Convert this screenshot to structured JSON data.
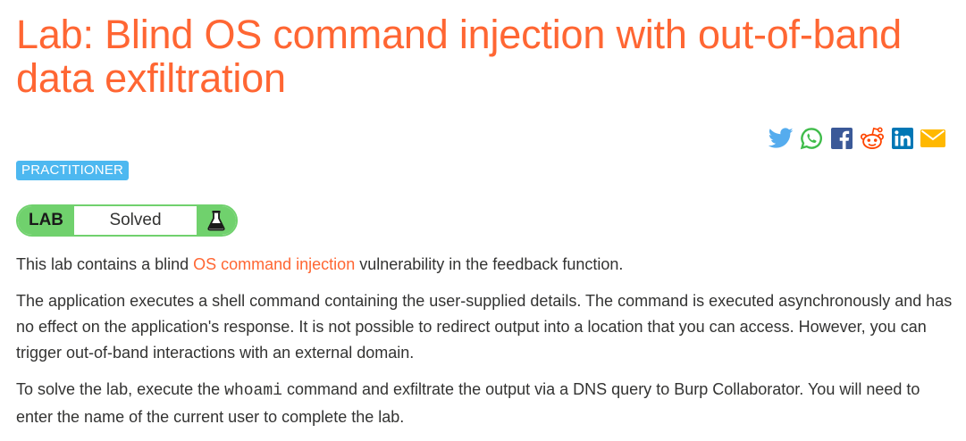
{
  "title": "Lab: Blind OS command injection with out-of-band data exfiltration",
  "share": {
    "icons": [
      "twitter-icon",
      "whatsapp-icon",
      "facebook-icon",
      "reddit-icon",
      "linkedin-icon",
      "email-icon"
    ],
    "colors": {
      "twitter": "#55acee",
      "whatsapp": "#3fbc4a",
      "facebook": "#3b5998",
      "reddit": "#ff4500",
      "linkedin": "#0077b5",
      "email": "#ffb800"
    }
  },
  "level_badge": "PRACTITIONER",
  "status": {
    "tag": "LAB",
    "text": "Solved"
  },
  "description": {
    "p1_before": "This lab contains a blind ",
    "p1_link": "OS command injection",
    "p1_after": " vulnerability in the feedback function.",
    "p2": "The application executes a shell command containing the user-supplied details. The command is executed asynchronously and has no effect on the application's response. It is not possible to redirect output into a location that you can access. However, you can trigger out-of-band interactions with an external domain.",
    "p3_before": "To solve the lab, execute the ",
    "p3_code": "whoami",
    "p3_after": " command and exfiltrate the output via a DNS query to Burp Collaborator. You will need to enter the name of the current user to complete the lab."
  },
  "colors": {
    "accent": "#ff6633",
    "badge": "#4db8f0",
    "solved": "#70d16d",
    "text": "#333332"
  }
}
